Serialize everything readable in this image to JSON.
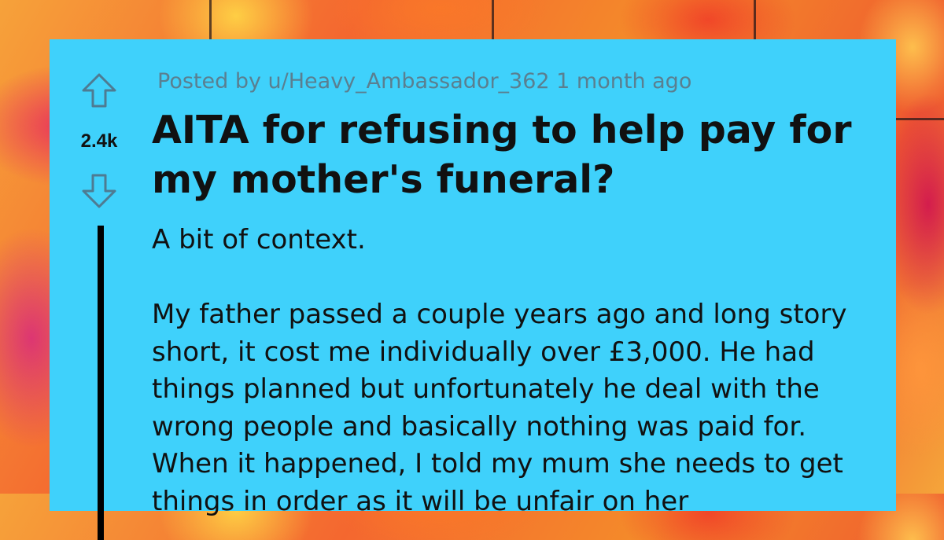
{
  "post": {
    "meta": "Posted by u/Heavy_Ambassador_362 1 month ago",
    "title": "AITA for refusing to help pay for my mother's funeral?",
    "votes": "2.4k",
    "body_paragraphs": [
      "A bit of context.",
      "My father passed a couple years ago and long story short, it cost me individually over £3,000. He had things planned but unfortunately he deal with the wrong people and basically nothing was paid for. When it happened, I told my mum she needs to get things in order as it will be unfair on her"
    ]
  },
  "icons": {
    "upvote": "upvote-arrow-icon",
    "downvote": "downvote-arrow-icon"
  },
  "colors": {
    "card_background": "#3fd1fb",
    "text": "#111111",
    "meta_text": "#5a7f90",
    "thread_line": "#000000"
  }
}
